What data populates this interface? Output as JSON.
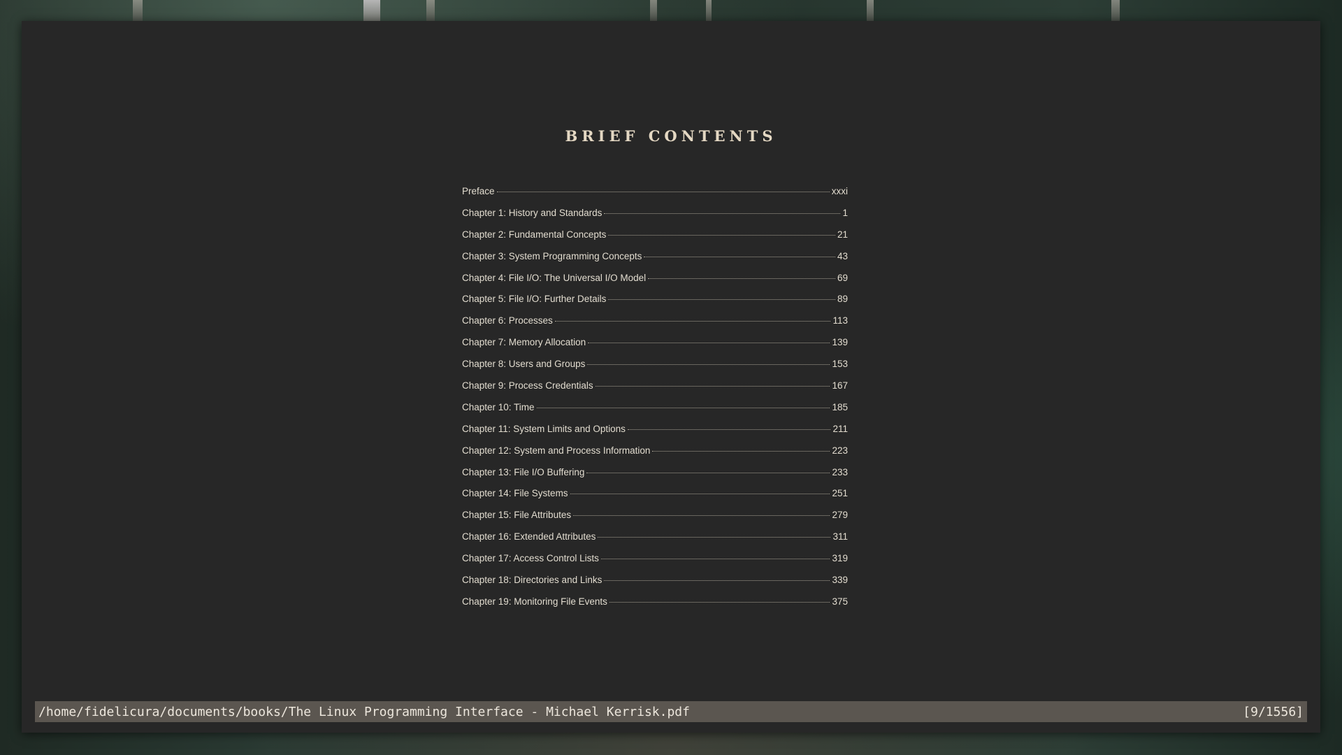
{
  "document": {
    "heading": "BRIEF CONTENTS",
    "toc": [
      {
        "label": "Preface",
        "page": "xxxi"
      },
      {
        "label": "Chapter 1: History and Standards",
        "page": "1"
      },
      {
        "label": "Chapter 2: Fundamental Concepts",
        "page": "21"
      },
      {
        "label": "Chapter 3: System Programming Concepts",
        "page": "43"
      },
      {
        "label": "Chapter 4: File I/O: The Universal I/O Model",
        "page": "69"
      },
      {
        "label": "Chapter 5: File I/O: Further Details",
        "page": "89"
      },
      {
        "label": "Chapter 6: Processes",
        "page": "113"
      },
      {
        "label": "Chapter 7: Memory Allocation",
        "page": "139"
      },
      {
        "label": "Chapter 8: Users and Groups",
        "page": "153"
      },
      {
        "label": "Chapter 9: Process Credentials",
        "page": "167"
      },
      {
        "label": "Chapter 10: Time",
        "page": "185"
      },
      {
        "label": "Chapter 11: System Limits and Options",
        "page": "211"
      },
      {
        "label": "Chapter 12: System and Process Information",
        "page": "223"
      },
      {
        "label": "Chapter 13: File I/O Buffering",
        "page": "233"
      },
      {
        "label": "Chapter 14: File Systems",
        "page": "251"
      },
      {
        "label": "Chapter 15: File Attributes",
        "page": "279"
      },
      {
        "label": "Chapter 16: Extended Attributes",
        "page": "311"
      },
      {
        "label": "Chapter 17: Access Control Lists",
        "page": "319"
      },
      {
        "label": "Chapter 18: Directories and Links",
        "page": "339"
      },
      {
        "label": "Chapter 19: Monitoring File Events",
        "page": "375"
      }
    ]
  },
  "statusbar": {
    "file_path": "/home/fidelicura/documents/books/The Linux Programming Interface - Michael Kerrisk.pdf",
    "page_indicator": "[9/1556]"
  },
  "colors": {
    "window_background": "#272727",
    "heading": "#e4d8c3",
    "text": "#e2dccf",
    "statusbar_background": "#5b5650",
    "statusbar_text": "#ece6dc"
  }
}
